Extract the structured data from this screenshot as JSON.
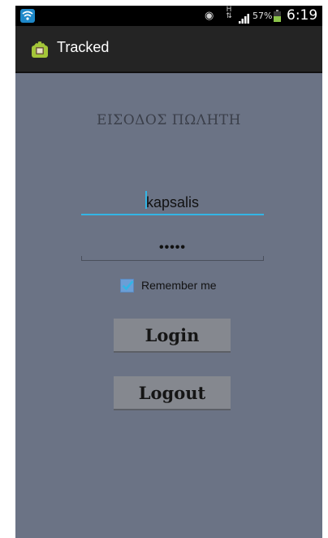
{
  "status_bar": {
    "battery_percent": "57%",
    "battery_level": 0.57,
    "time": "6:19",
    "hspa_label": "H",
    "icons": [
      "wifi-icon",
      "eye-icon",
      "hspa-plus-icon",
      "signal-icon",
      "battery-icon"
    ]
  },
  "action_bar": {
    "title": "Tracked",
    "icon": "android-app-icon"
  },
  "form": {
    "title": "ΕΙΣΟΔΟΣ ΠΩΛΗΤΗ",
    "username_value": "kapsalis",
    "password_value": "•••••",
    "remember_label": "Remember me",
    "remember_checked": true,
    "login_label": "Login",
    "logout_label": "Logout"
  },
  "colors": {
    "background": "#6b7385",
    "accent": "#33b5e5",
    "button": "#85888f",
    "action_bar": "#242424"
  }
}
